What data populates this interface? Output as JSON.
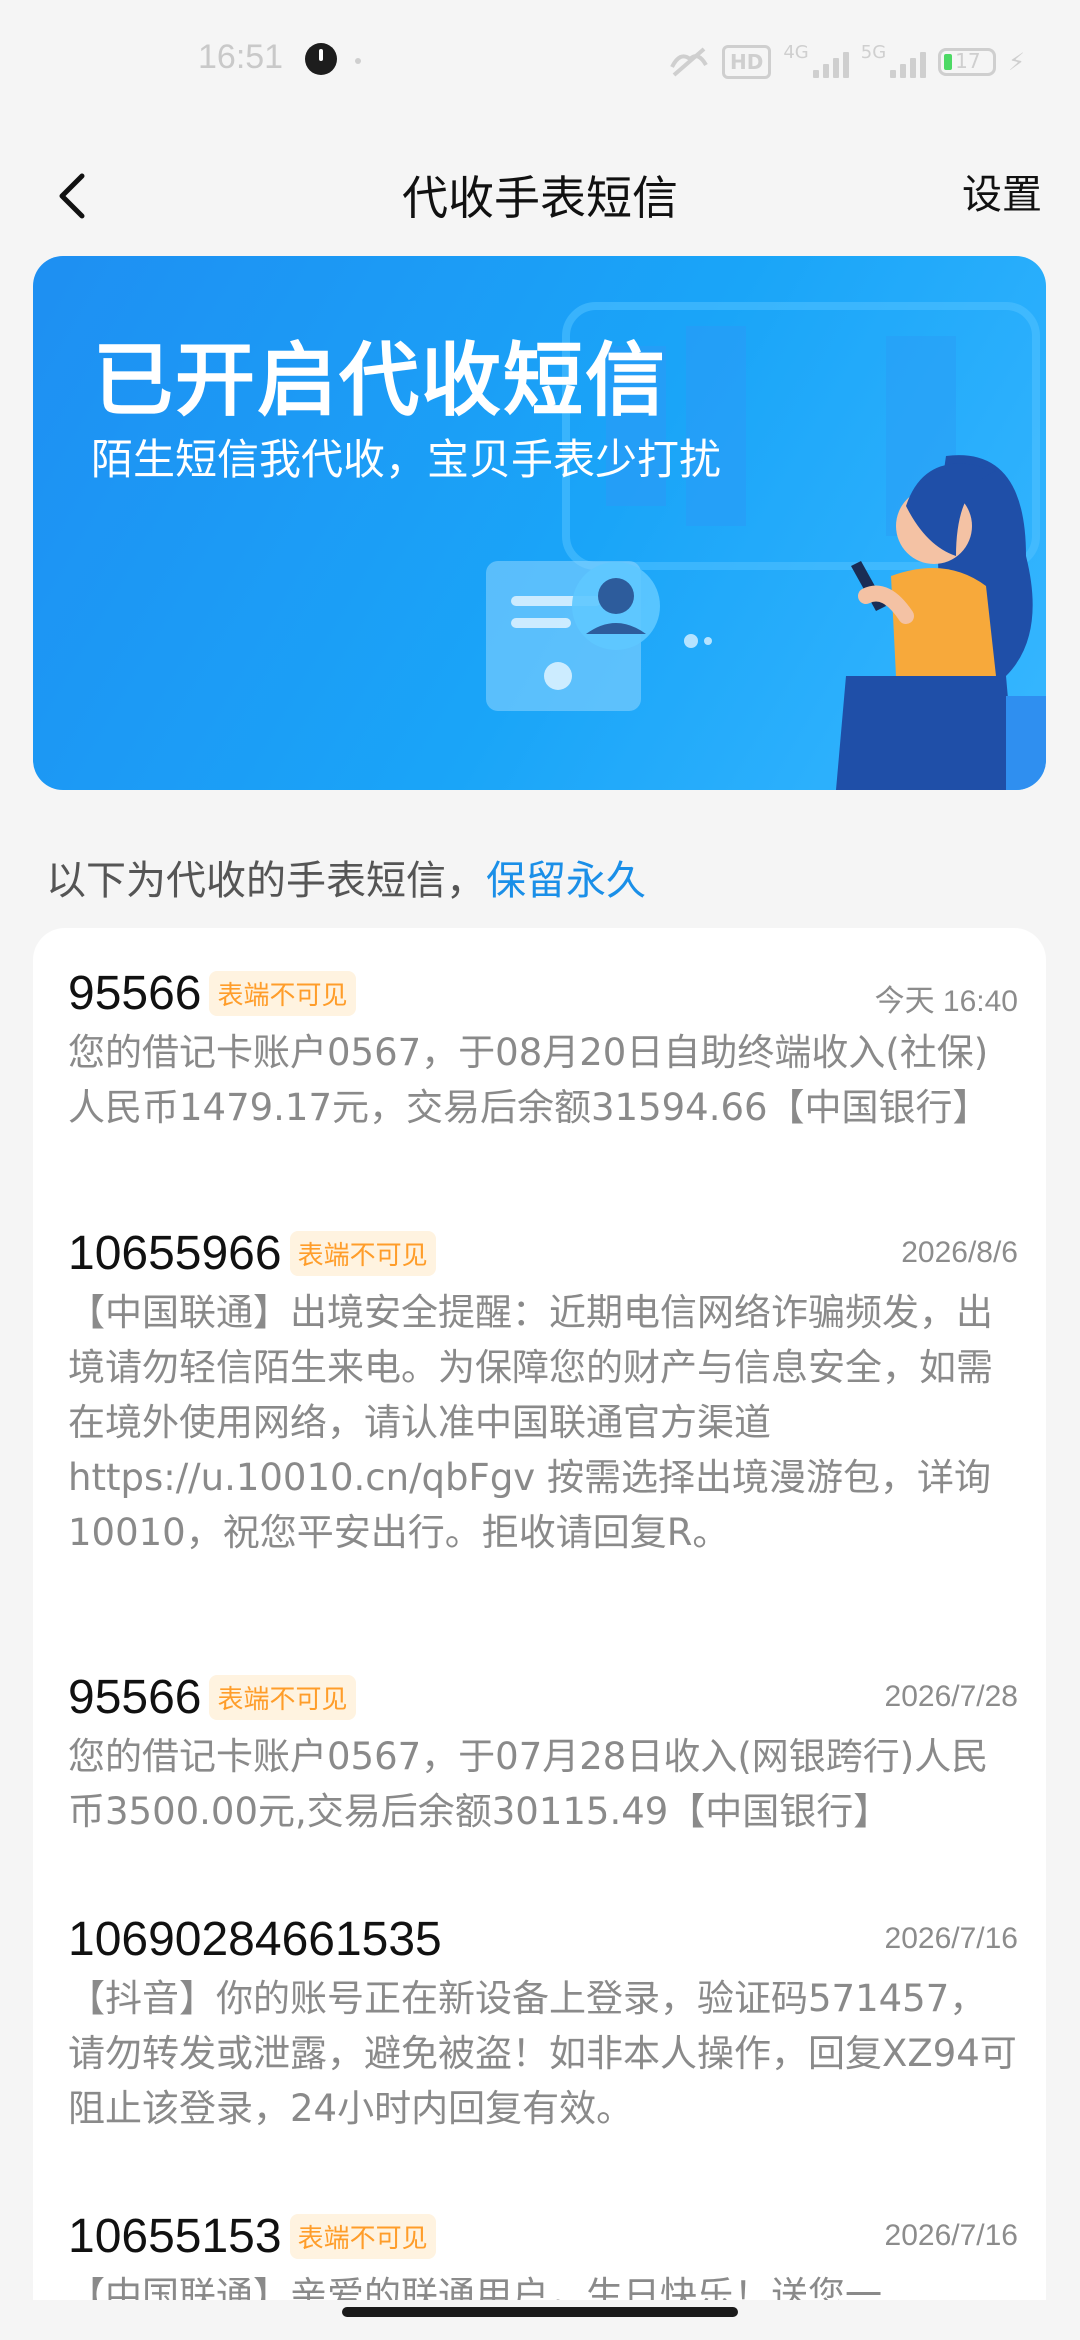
{
  "status_bar": {
    "time": "16:51",
    "network_badge": "HD",
    "net1": "4G",
    "net2": "5G",
    "battery": "17"
  },
  "header": {
    "title": "代收手表短信",
    "settings_label": "设置"
  },
  "banner": {
    "title": "已开启代收短信",
    "subtitle": "陌生短信我代收，宝贝手表少打扰"
  },
  "section": {
    "prefix": "以下为代收的手表短信，",
    "highlight": "保留永久"
  },
  "messages": [
    {
      "sender": "95566",
      "tag": "表端不可见",
      "date": "今天 16:40",
      "body": "您的借记卡账户0567，于08月20日自助终端收入(社保)人民币1479.17元，交易后余额31594.66【中国银行】"
    },
    {
      "sender": "10655966",
      "tag": "表端不可见",
      "date": "2026/8/6",
      "body": "【中国联通】出境安全提醒：近期电信网络诈骗频发，出境请勿轻信陌生来电。为保障您的财产与信息安全，如需在境外使用网络，请认准中国联通官方渠道 https://u.10010.cn/qbFgv 按需选择出境漫游包，详询10010，祝您平安出行。拒收请回复R。"
    },
    {
      "sender": "95566",
      "tag": "表端不可见",
      "date": "2026/7/28",
      "body": "您的借记卡账户0567，于07月28日收入(网银跨行)人民币3500.00元,交易后余额30115.49【中国银行】"
    },
    {
      "sender": "10690284661535",
      "tag": "",
      "date": "2026/7/16",
      "body": "【抖音】你的账号正在新设备上登录，验证码571457，请勿转发或泄露，避免被盗！如非本人操作，回复XZ94可阻止该登录，24小时内回复有效。"
    },
    {
      "sender": "10655153",
      "tag": "表端不可见",
      "date": "2026/7/16",
      "body": "【中国联通】亲爱的联通用户，生日快乐！送您一"
    }
  ]
}
